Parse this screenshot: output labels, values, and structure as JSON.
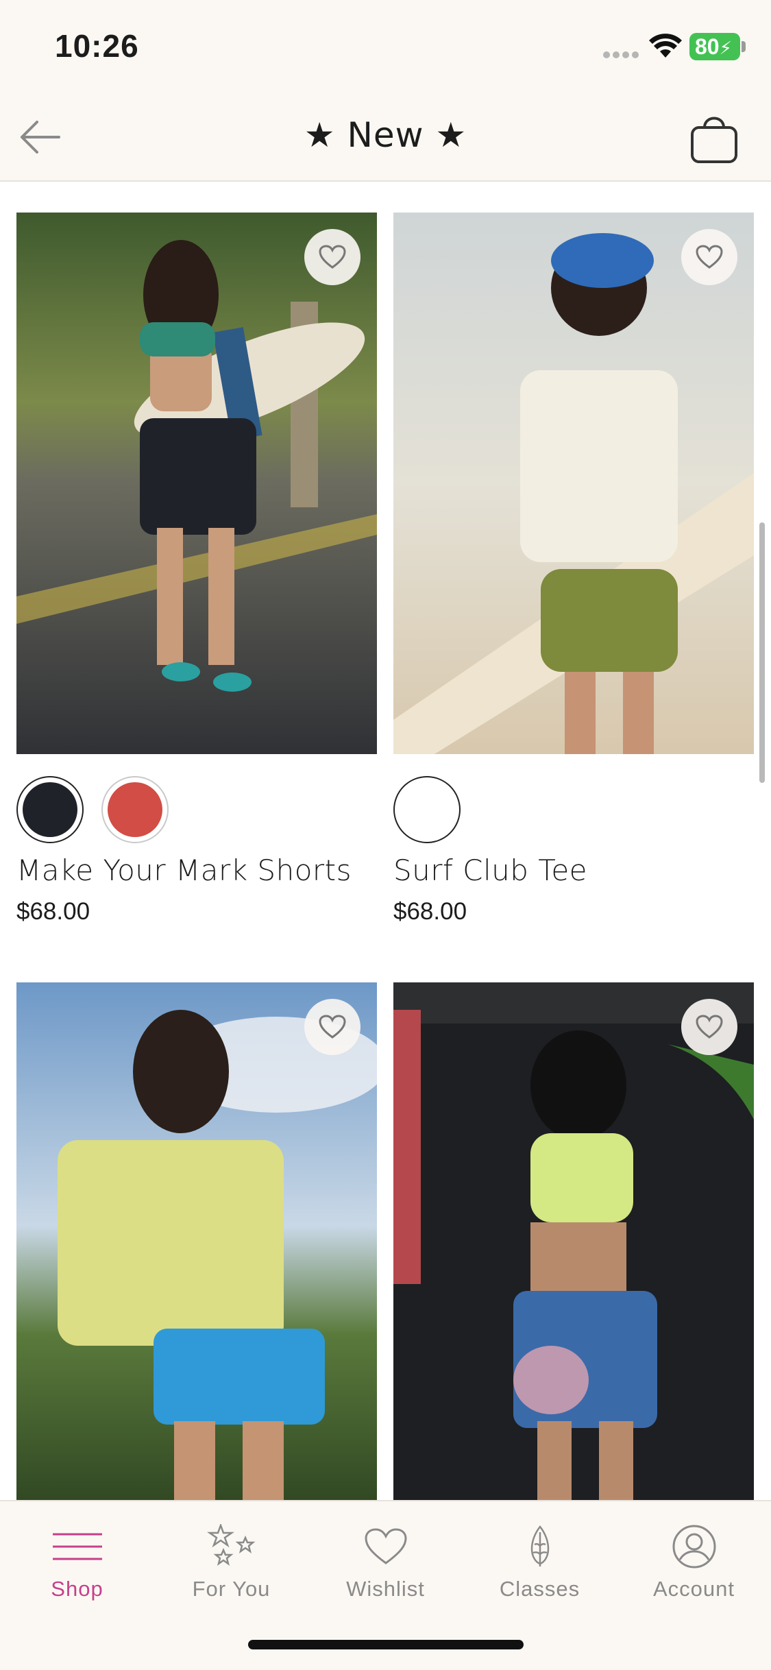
{
  "status_bar": {
    "time": "10:26",
    "battery": "80"
  },
  "header": {
    "title": "★ New ★"
  },
  "products": [
    {
      "name": "Make Your Mark Shorts",
      "price": "$68.00",
      "swatches": [
        "#1f2329",
        "#d24d45"
      ]
    },
    {
      "name": "Surf Club Tee",
      "price": "$68.00",
      "swatches": [
        "#ffffff"
      ]
    },
    {
      "name": "",
      "price": "",
      "swatches": []
    },
    {
      "name": "",
      "price": "",
      "swatches": []
    }
  ],
  "tabs": [
    {
      "label": "Shop",
      "icon": "menu-icon",
      "active": true
    },
    {
      "label": "For You",
      "icon": "stars-icon",
      "active": false
    },
    {
      "label": "Wishlist",
      "icon": "heart-icon",
      "active": false
    },
    {
      "label": "Classes",
      "icon": "lotus-icon",
      "active": false
    },
    {
      "label": "Account",
      "icon": "account-icon",
      "active": false
    }
  ],
  "colors": {
    "accent": "#c73f8b",
    "header_bg": "#fbf8f3",
    "battery": "#43c253"
  }
}
